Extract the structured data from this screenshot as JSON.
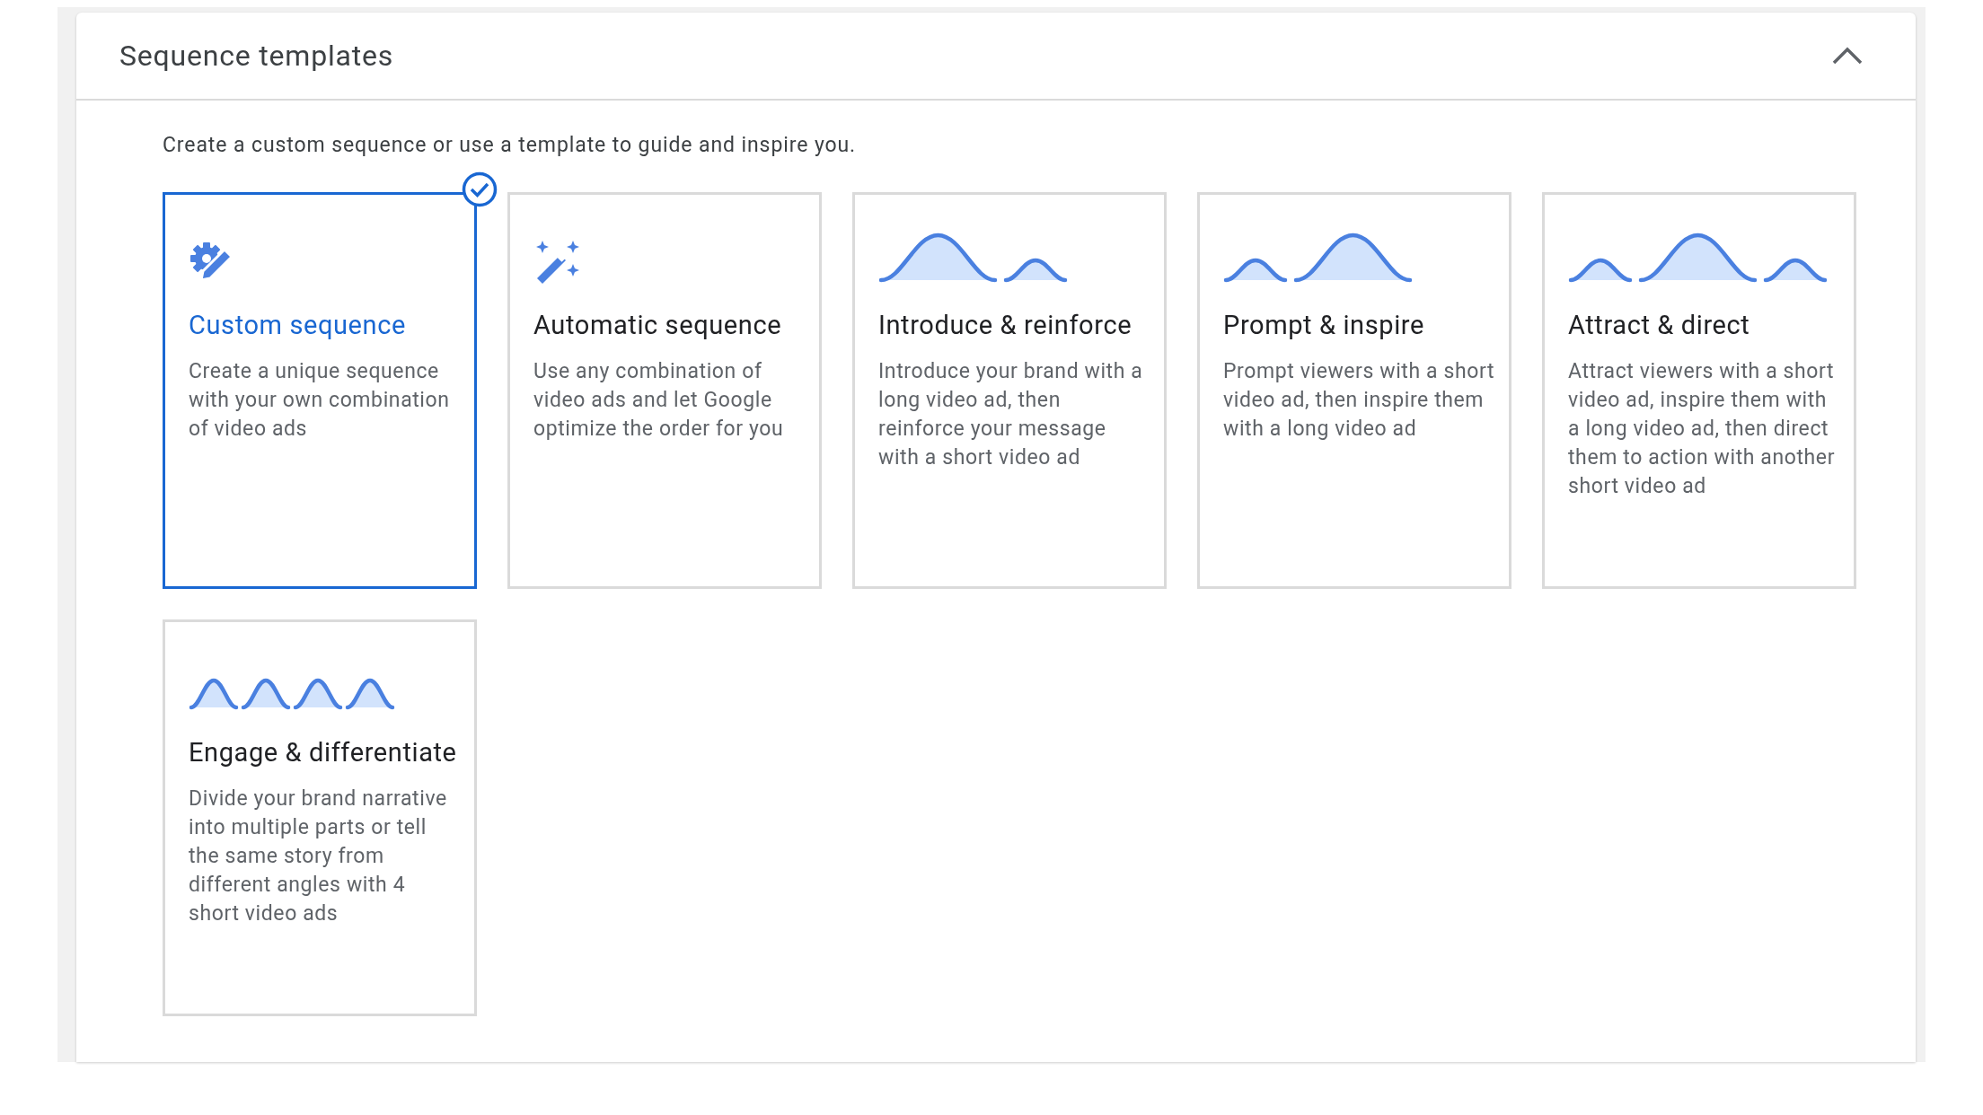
{
  "panel": {
    "title": "Sequence templates",
    "expanded": true
  },
  "intro": "Create a custom sequence or use a template to guide and inspire you.",
  "cards": [
    {
      "kind": "custom",
      "title": "Custom sequence",
      "description": "Create a unique sequence with your own combination of video ads",
      "selected": true
    },
    {
      "kind": "automatic",
      "title": "Automatic sequence",
      "description": "Use any combination of video ads and let Google optimize the order for you",
      "selected": false
    },
    {
      "kind": "introduce",
      "title": "Introduce & reinforce",
      "description": "Introduce your brand with a long video ad, then reinforce your message with a short video ad",
      "selected": false
    },
    {
      "kind": "prompt",
      "title": "Prompt & inspire",
      "description": "Prompt viewers with a short video ad, then inspire them with a long video ad",
      "selected": false
    },
    {
      "kind": "attract",
      "title": "Attract & direct",
      "description": "Attract viewers with a short video ad, inspire them with a long video ad, then direct them to action with another short video ad",
      "selected": false
    },
    {
      "kind": "engage",
      "title": "Engage & differentiate",
      "description": "Divide your brand narrative into multiple parts or tell the same story from different angles with 4 short video ads",
      "selected": false
    }
  ]
}
